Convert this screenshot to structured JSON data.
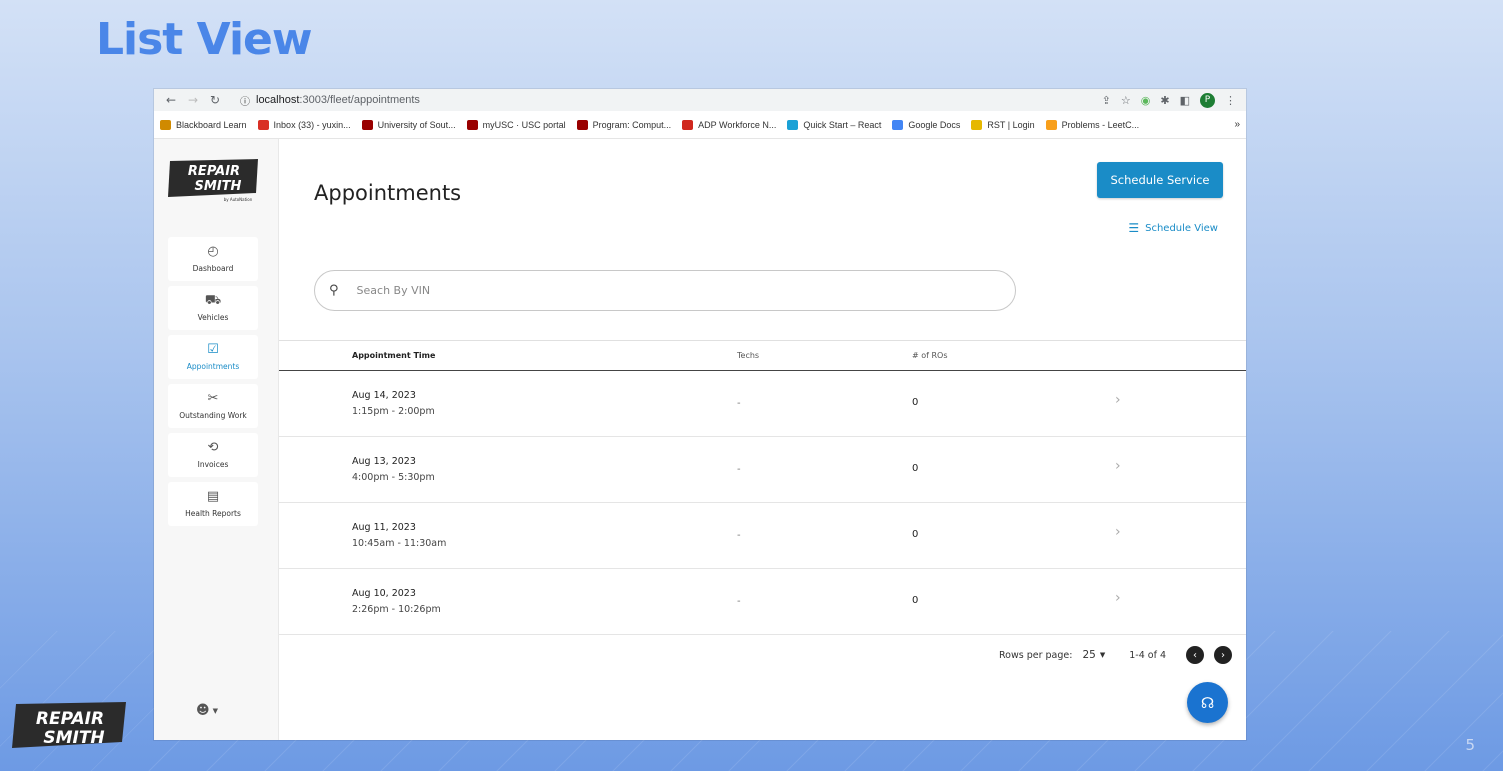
{
  "slide": {
    "title": "List View",
    "page_number": "5",
    "logo_line1": "REPAIR",
    "logo_line2": "SMITH"
  },
  "browser": {
    "url_host": "localhost",
    "url_path": ":3003/fleet/appointments",
    "profile_initial": "P",
    "bookmarks": [
      {
        "label": "Blackboard Learn",
        "icon": "bar-chart-icon",
        "color": "#d08a00"
      },
      {
        "label": "Inbox (33) - yuxin...",
        "icon": "gmail-icon",
        "color": "#d93025"
      },
      {
        "label": "University of Sout...",
        "icon": "usc-icon",
        "color": "#990000"
      },
      {
        "label": "myUSC · USC portal",
        "icon": "usc-icon",
        "color": "#990000"
      },
      {
        "label": "Program: Comput...",
        "icon": "usc-icon",
        "color": "#990000"
      },
      {
        "label": "ADP Workforce N...",
        "icon": "adp-icon",
        "color": "#d0271d"
      },
      {
        "label": "Quick Start – React",
        "icon": "react-icon",
        "color": "#1aa1d6"
      },
      {
        "label": "Google Docs",
        "icon": "docs-icon",
        "color": "#4285f4"
      },
      {
        "label": "RST | Login",
        "icon": "rst-icon",
        "color": "#e6b800"
      },
      {
        "label": "Problems - LeetC...",
        "icon": "leetcode-icon",
        "color": "#f89f1b"
      }
    ],
    "more_label": "»"
  },
  "app": {
    "logo_line1": "REPAIR",
    "logo_line2": "SMITH",
    "logo_sub": "by AutoNation",
    "nav": [
      {
        "label": "Dashboard",
        "icon": "speedometer-icon",
        "glyph": "◴",
        "active": false
      },
      {
        "label": "Vehicles",
        "icon": "truck-icon",
        "glyph": "⛟",
        "active": false
      },
      {
        "label": "Appointments",
        "icon": "calendar-check-icon",
        "glyph": "☑",
        "active": true
      },
      {
        "label": "Outstanding Work",
        "icon": "tools-icon",
        "glyph": "✂",
        "active": false
      },
      {
        "label": "Invoices",
        "icon": "dollar-history-icon",
        "glyph": "⟲",
        "active": false
      },
      {
        "label": "Health Reports",
        "icon": "clipboard-icon",
        "glyph": "▤",
        "active": false
      }
    ],
    "page_title": "Appointments",
    "schedule_service_label": "Schedule Service",
    "schedule_view_label": "Schedule View",
    "search_placeholder": "Seach By VIN",
    "table": {
      "headers": {
        "time": "Appointment Time",
        "techs": "Techs",
        "ros": "# of ROs"
      },
      "rows": [
        {
          "date": "Aug 14, 2023",
          "range": "1:15pm - 2:00pm",
          "techs": "-",
          "ros": "0"
        },
        {
          "date": "Aug 13, 2023",
          "range": "4:00pm - 5:30pm",
          "techs": "-",
          "ros": "0"
        },
        {
          "date": "Aug 11, 2023",
          "range": "10:45am - 11:30am",
          "techs": "-",
          "ros": "0"
        },
        {
          "date": "Aug 10, 2023",
          "range": "2:26pm - 10:26pm",
          "techs": "-",
          "ros": "0"
        }
      ]
    },
    "pagination": {
      "rows_per_page_label": "Rows per page:",
      "rows_per_page": "25",
      "range": "1-4 of 4"
    }
  }
}
